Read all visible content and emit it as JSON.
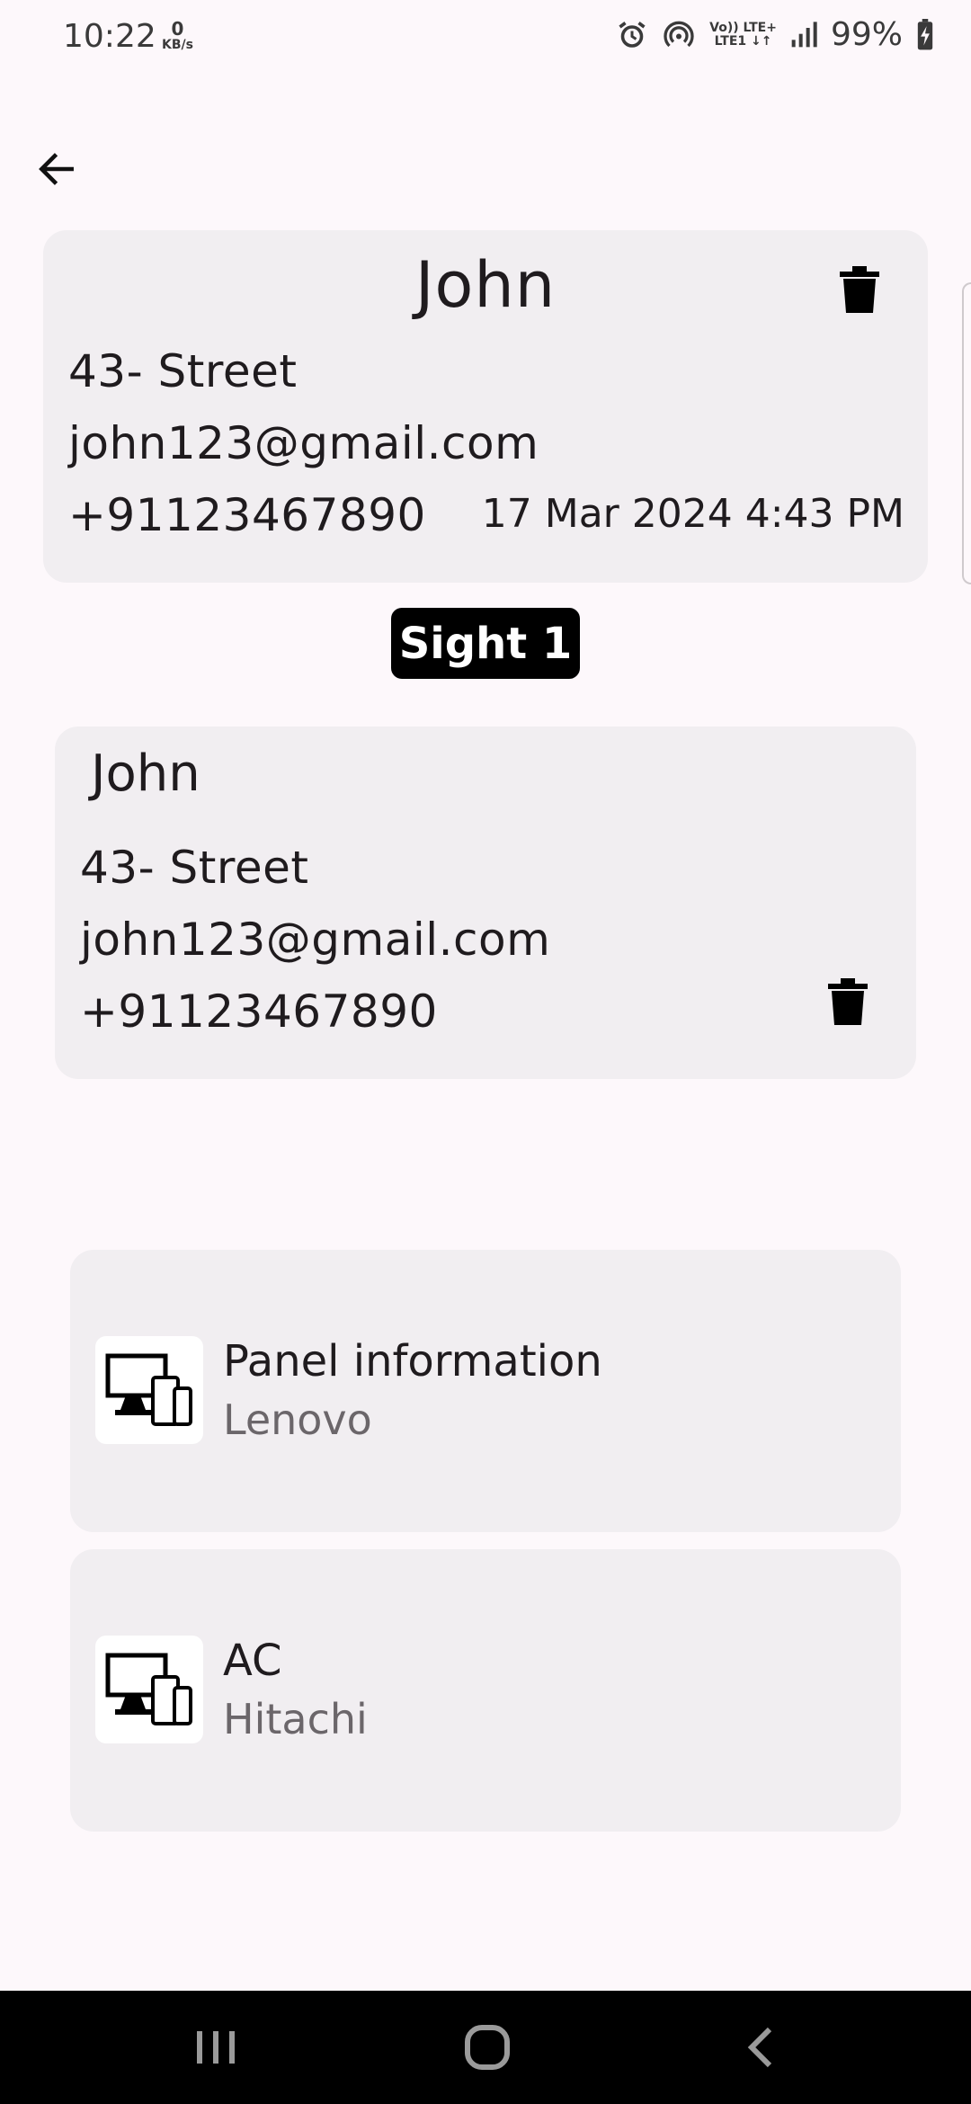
{
  "status_bar": {
    "time": "10:22",
    "speed_value": "0",
    "speed_unit": "KB/s",
    "net_top": "Vo)) LTE+",
    "net_bottom": "LTE1 ↓↑",
    "battery": "99%"
  },
  "customer_card": {
    "name": "John",
    "address": "43- Street",
    "email": "john123@gmail.com",
    "phone": "+91123467890",
    "date": "17 Mar 2024 4:43 PM"
  },
  "sight_badge": "Sight 1",
  "sight_card": {
    "name": "John",
    "address": "43- Street",
    "email": "john123@gmail.com",
    "phone": "+91123467890"
  },
  "devices": [
    {
      "title": "Panel information",
      "brand": "Lenovo",
      "icon": "devices-icon"
    },
    {
      "title": "AC",
      "brand": "Hitachi",
      "icon": "devices-icon"
    }
  ],
  "colors": {
    "background": "#fdf8fb",
    "card": "#f1eef1",
    "badge": "#000000",
    "navbar": "#000000"
  }
}
